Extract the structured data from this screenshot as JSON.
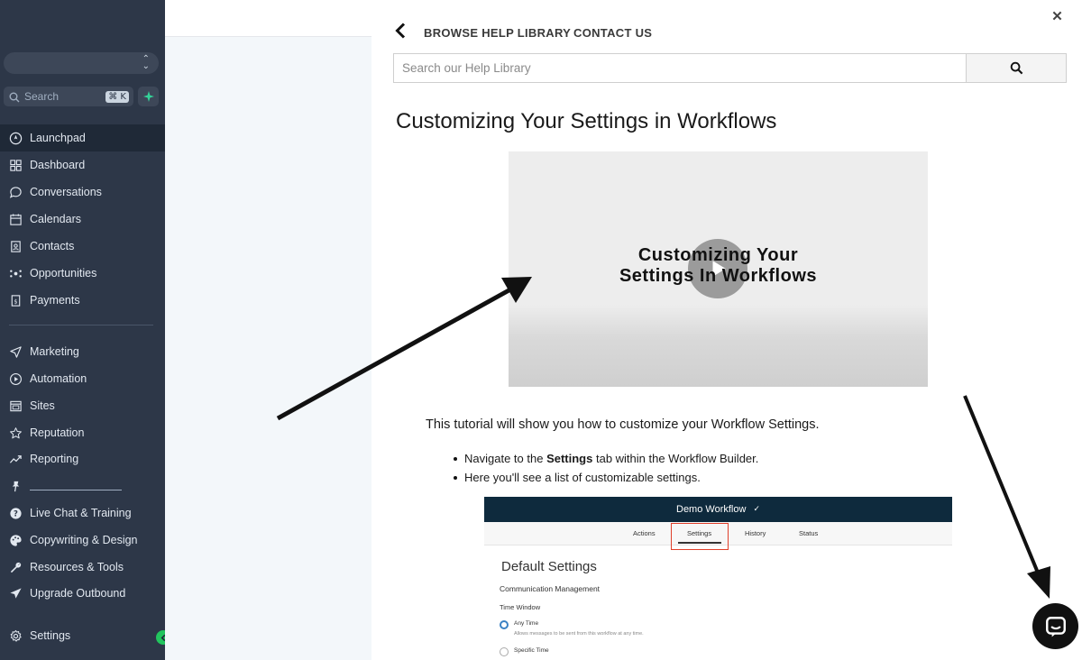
{
  "sidebar": {
    "search_label": "Search",
    "search_shortcut": "⌘ K",
    "items_primary": [
      {
        "label": "Launchpad",
        "icon": "rocket-icon",
        "active": true
      },
      {
        "label": "Dashboard",
        "icon": "dashboard-grid-icon"
      },
      {
        "label": "Conversations",
        "icon": "chat-bubble-icon"
      },
      {
        "label": "Calendars",
        "icon": "calendar-icon"
      },
      {
        "label": "Contacts",
        "icon": "contacts-book-icon"
      },
      {
        "label": "Opportunities",
        "icon": "opportunities-network-icon"
      },
      {
        "label": "Payments",
        "icon": "payments-receipt-icon"
      }
    ],
    "items_secondary": [
      {
        "label": "Marketing",
        "icon": "paper-plane-icon"
      },
      {
        "label": "Automation",
        "icon": "automation-play-icon"
      },
      {
        "label": "Sites",
        "icon": "sites-window-icon"
      },
      {
        "label": "Reputation",
        "icon": "star-icon"
      },
      {
        "label": "Reporting",
        "icon": "trend-line-icon"
      }
    ],
    "items_tertiary": [
      {
        "label": "Live Chat & Training",
        "icon": "question-circle-icon"
      },
      {
        "label": "Copywriting & Design",
        "icon": "palette-icon"
      },
      {
        "label": "Resources & Tools",
        "icon": "wrench-icon"
      },
      {
        "label": "Upgrade Outbound",
        "icon": "send-icon"
      }
    ],
    "settings_label": "Settings"
  },
  "help": {
    "browse_label": "BROWSE HELP LIBRARY",
    "contact_label": "CONTACT US",
    "search_placeholder": "Search our Help Library",
    "article_title": "Customizing Your Settings in Workflows",
    "video_title_line1": "Customizing Your",
    "video_title_line2": "Settings In Workflows",
    "intro": "This tutorial will show you how to customize your Workflow Settings.",
    "bullet1_pre": "Navigate to the ",
    "bullet1_bold": "Settings",
    "bullet1_post": " tab within the Workflow Builder.",
    "bullet2": "Here you'll see a list of customizable settings."
  },
  "embed": {
    "header_title": "Demo Workflow",
    "header_edit_icon": "✓",
    "tabs": [
      "Actions",
      "Settings",
      "History",
      "Status"
    ],
    "heading": "Default Settings",
    "section": "Communication Management",
    "time_window_label": "Time Window",
    "option1_label": "Any Time",
    "option1_desc": "Allows messages to be sent from this workflow at any time.",
    "option2_label": "Specific Time"
  },
  "colors": {
    "sidebar_bg": "#2d3748",
    "embed_header": "#0e2a3d",
    "highlight_box": "#e0402b",
    "collapse_accent": "#22c55e"
  }
}
